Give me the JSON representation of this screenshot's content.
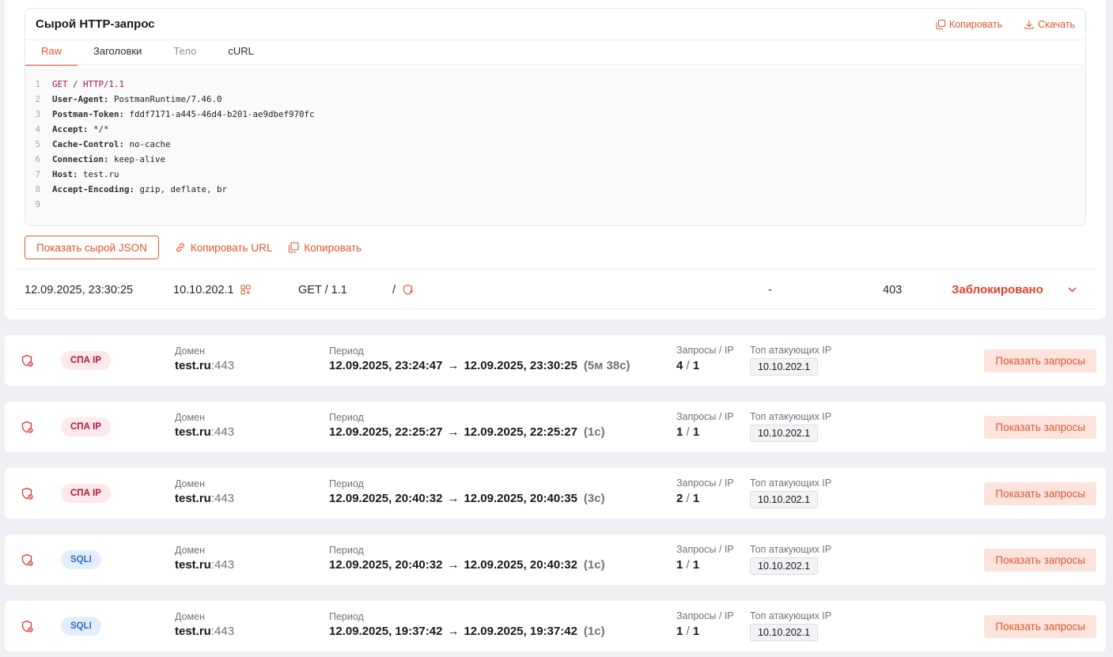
{
  "raw_request": {
    "title": "Сырой HTTP-запрос",
    "copy_label": "Копировать",
    "download_label": "Скачать",
    "tabs": [
      {
        "label": "Raw",
        "active": true
      },
      {
        "label": "Заголовки",
        "active": false
      },
      {
        "label": "Тело",
        "active": false
      },
      {
        "label": "cURL",
        "active": false
      }
    ],
    "lines": [
      {
        "n": "1",
        "key": "",
        "value": "GET / HTTP/1.1"
      },
      {
        "n": "2",
        "key": "User-Agent:",
        "value": " PostmanRuntime/7.46.0"
      },
      {
        "n": "3",
        "key": "Postman-Token:",
        "value": " fddf7171-a445-46d4-b201-ae9dbef970fc"
      },
      {
        "n": "4",
        "key": "Accept:",
        "value": " */*"
      },
      {
        "n": "5",
        "key": "Cache-Control:",
        "value": " no-cache"
      },
      {
        "n": "6",
        "key": "Connection:",
        "value": " keep-alive"
      },
      {
        "n": "7",
        "key": "Host:",
        "value": " test.ru"
      },
      {
        "n": "8",
        "key": "Accept-Encoding:",
        "value": " gzip, deflate, br"
      },
      {
        "n": "9",
        "key": "",
        "value": ""
      }
    ]
  },
  "actions": {
    "show_json": "Показать сырой JSON",
    "copy_url": "Копировать URL",
    "copy": "Копировать"
  },
  "request_row": {
    "time": "12.09.2025, 23:30:25",
    "ip": "10.10.202.1",
    "method": "GET / 1.1",
    "path": "/",
    "dash": "-",
    "status": "403",
    "verdict": "Заблокировано"
  },
  "incidents": [
    {
      "badge": "СПА IP",
      "type": "spa",
      "domain_label": "Домен",
      "domain": "test.ru",
      "port": ":443",
      "period_label": "Период",
      "start": "12.09.2025, 23:24:47",
      "arrow": "→",
      "end": "12.09.2025, 23:30:25",
      "duration": "(5м 38с)",
      "req_label": "Запросы / IP",
      "requests": "4",
      "slash": "/",
      "ips": "1",
      "top_label": "Топ атакующих IP",
      "top_ip": "10.10.202.1",
      "button": "Показать запросы"
    },
    {
      "badge": "СПА IP",
      "type": "spa",
      "domain_label": "Домен",
      "domain": "test.ru",
      "port": ":443",
      "period_label": "Период",
      "start": "12.09.2025, 22:25:27",
      "arrow": "→",
      "end": "12.09.2025, 22:25:27",
      "duration": "(1с)",
      "req_label": "Запросы / IP",
      "requests": "1",
      "slash": "/",
      "ips": "1",
      "top_label": "Топ атакующих IP",
      "top_ip": "10.10.202.1",
      "button": "Показать запросы"
    },
    {
      "badge": "СПА IP",
      "type": "spa",
      "domain_label": "Домен",
      "domain": "test.ru",
      "port": ":443",
      "period_label": "Период",
      "start": "12.09.2025, 20:40:32",
      "arrow": "→",
      "end": "12.09.2025, 20:40:35",
      "duration": "(3с)",
      "req_label": "Запросы / IP",
      "requests": "2",
      "slash": "/",
      "ips": "1",
      "top_label": "Топ атакующих IP",
      "top_ip": "10.10.202.1",
      "button": "Показать запросы"
    },
    {
      "badge": "SQLI",
      "type": "sqli",
      "domain_label": "Домен",
      "domain": "test.ru",
      "port": ":443",
      "period_label": "Период",
      "start": "12.09.2025, 20:40:32",
      "arrow": "→",
      "end": "12.09.2025, 20:40:32",
      "duration": "(1с)",
      "req_label": "Запросы / IP",
      "requests": "1",
      "slash": "/",
      "ips": "1",
      "top_label": "Топ атакующих IP",
      "top_ip": "10.10.202.1",
      "button": "Показать запросы"
    },
    {
      "badge": "SQLI",
      "type": "sqli",
      "domain_label": "Домен",
      "domain": "test.ru",
      "port": ":443",
      "period_label": "Период",
      "start": "12.09.2025, 19:37:42",
      "arrow": "→",
      "end": "12.09.2025, 19:37:42",
      "duration": "(1с)",
      "req_label": "Запросы / IP",
      "requests": "1",
      "slash": "/",
      "ips": "1",
      "top_label": "Топ атакующих IP",
      "top_ip": "10.10.202.1",
      "button": "Показать запросы"
    }
  ],
  "colors": {
    "accent": "#e0572d",
    "danger": "#e0402d",
    "spa_badge": "#b0163a",
    "sqli_badge": "#2a6bc9"
  }
}
